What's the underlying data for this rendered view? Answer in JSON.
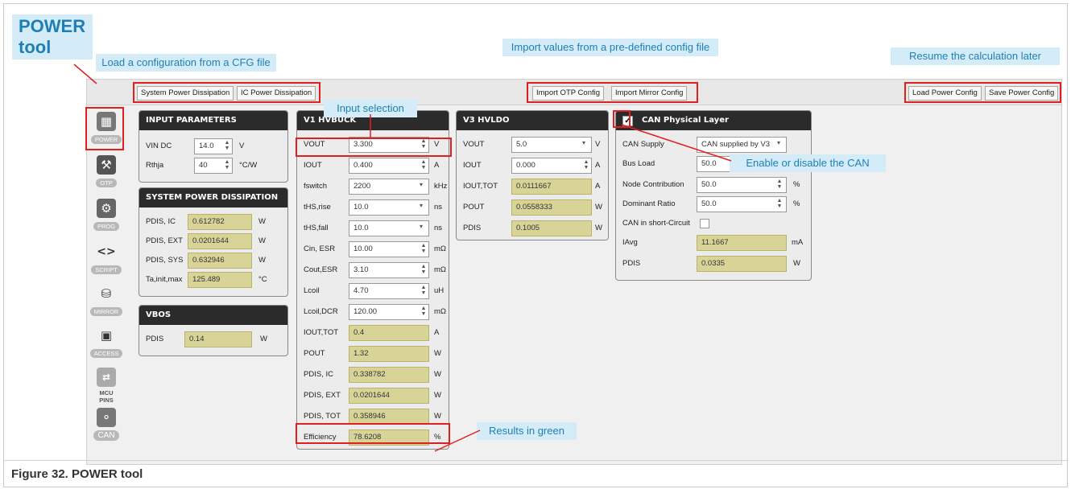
{
  "title": "POWER\ntool",
  "callouts": {
    "load_cfg": "Load a configuration from a CFG file",
    "import_values": "Import values from a pre-defined config file",
    "resume": "Resume the calculation later",
    "input_selection": "Input selection",
    "enable_can": "Enable or disable the CAN",
    "results_green": "Results in green"
  },
  "toolbar": {
    "system_power": "System Power Dissipation",
    "ic_power": "IC Power Dissipation",
    "import_otp": "Import OTP Config",
    "import_mirror": "Import Mirror Config",
    "load_power": "Load Power Config",
    "save_power": "Save Power Config"
  },
  "sidebar": [
    {
      "label": "POWER",
      "icon": "calculator-icon"
    },
    {
      "label": "OTP",
      "icon": "wrench-icon"
    },
    {
      "label": "PROG",
      "icon": "gear-icon"
    },
    {
      "label": "SCRIPT",
      "icon": "code-icon"
    },
    {
      "label": "MIRROR",
      "icon": "mirror-icon"
    },
    {
      "label": "ACCESS",
      "icon": "chip-icon"
    },
    {
      "label": "MCU PINS",
      "icon": "pins-icon"
    },
    {
      "label": "CAN",
      "icon": "network-icon"
    }
  ],
  "input_params": {
    "title": "INPUT PARAMETERS",
    "vin_label": "VIN DC",
    "vin_value": "14.0",
    "vin_unit": "V",
    "rthja_label": "Rthja",
    "rthja_value": "40",
    "rthja_unit": "°C/W"
  },
  "system_power": {
    "title": "SYSTEM POWER DISSIPATION",
    "rows": [
      {
        "label": "PDIS, IC",
        "value": "0.612782",
        "unit": "W"
      },
      {
        "label": "PDIS, EXT",
        "value": "0.0201644",
        "unit": "W"
      },
      {
        "label": "PDIS, SYS",
        "value": "0.632946",
        "unit": "W"
      },
      {
        "label": "Ta,init,max",
        "value": "125.489",
        "unit": "°C"
      }
    ]
  },
  "vbos": {
    "title": "VBOS",
    "label": "PDIS",
    "value": "0.14",
    "unit": "W"
  },
  "v1": {
    "title": "V1 HVBUCK",
    "rows": [
      {
        "label": "VOUT",
        "value": "3.300",
        "unit": "V",
        "kind": "spin"
      },
      {
        "label": "IOUT",
        "value": "0.400",
        "unit": "A",
        "kind": "spin"
      },
      {
        "label": "fswitch",
        "value": "2200",
        "unit": "kHz",
        "kind": "dd"
      },
      {
        "label": "tHS,rise",
        "value": "10.0",
        "unit": "ns",
        "kind": "dd"
      },
      {
        "label": "tHS,fall",
        "value": "10.0",
        "unit": "ns",
        "kind": "dd"
      },
      {
        "label": "Cin, ESR",
        "value": "10.00",
        "unit": "mΩ",
        "kind": "spin"
      },
      {
        "label": "Cout,ESR",
        "value": "3.10",
        "unit": "mΩ",
        "kind": "spin"
      },
      {
        "label": "Lcoil",
        "value": "4.70",
        "unit": "uH",
        "kind": "spin"
      },
      {
        "label": "Lcoil,DCR",
        "value": "120.00",
        "unit": "mΩ",
        "kind": "spin"
      },
      {
        "label": "IOUT,TOT",
        "value": "0.4",
        "unit": "A",
        "kind": "out"
      },
      {
        "label": "POUT",
        "value": "1.32",
        "unit": "W",
        "kind": "out"
      },
      {
        "label": "PDIS, IC",
        "value": "0.338782",
        "unit": "W",
        "kind": "out"
      },
      {
        "label": "PDIS, EXT",
        "value": "0.0201644",
        "unit": "W",
        "kind": "out"
      },
      {
        "label": "PDIS, TOT",
        "value": "0.358946",
        "unit": "W",
        "kind": "out"
      },
      {
        "label": "Efficiency",
        "value": "78.6208",
        "unit": "%",
        "kind": "out"
      }
    ]
  },
  "v3": {
    "title": "V3 HVLDO",
    "rows": [
      {
        "label": "VOUT",
        "value": "5.0",
        "unit": "V",
        "kind": "dd"
      },
      {
        "label": "IOUT",
        "value": "0.000",
        "unit": "A",
        "kind": "spin"
      },
      {
        "label": "IOUT,TOT",
        "value": "0.0111667",
        "unit": "A",
        "kind": "out"
      },
      {
        "label": "POUT",
        "value": "0.0558333",
        "unit": "W",
        "kind": "out"
      },
      {
        "label": "PDIS",
        "value": "0.1005",
        "unit": "W",
        "kind": "out"
      }
    ]
  },
  "can": {
    "title": "CAN Physical Layer",
    "enabled_mark": "✓",
    "supply_label": "CAN Supply",
    "supply_value": "CAN supplied by V3",
    "bus_label": "Bus Load",
    "bus_value": "50.0",
    "node_label": "Node Contribution",
    "node_value": "50.0",
    "node_unit": "%",
    "dom_label": "Dominant Ratio",
    "dom_value": "50.0",
    "dom_unit": "%",
    "short_label": "CAN in short-Circuit",
    "iavg_label": "IAvg",
    "iavg_value": "11.1667",
    "iavg_unit": "mA",
    "pdis_label": "PDIS",
    "pdis_value": "0.0335",
    "pdis_unit": "W"
  },
  "caption": "Figure 32.  POWER tool",
  "colors": {
    "result_fill": "#d8d498",
    "callout_bg": "#d4ecf7",
    "callout_text": "#1f7fb5",
    "highlight": "#e02020"
  }
}
